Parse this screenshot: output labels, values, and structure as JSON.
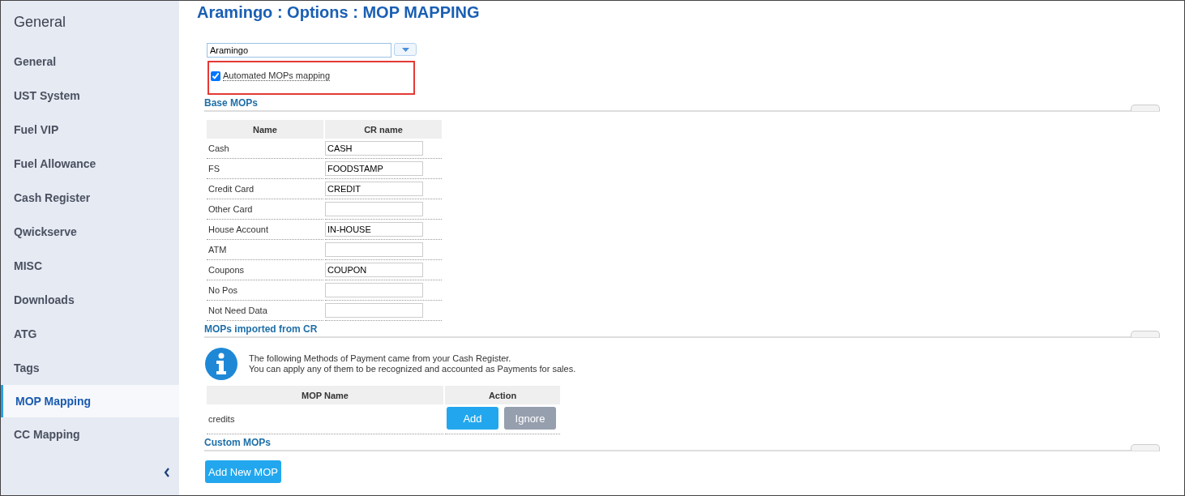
{
  "sidebar": {
    "heading": "General",
    "items": [
      {
        "label": "General",
        "selected": false
      },
      {
        "label": "UST System",
        "selected": false
      },
      {
        "label": "Fuel VIP",
        "selected": false
      },
      {
        "label": "Fuel Allowance",
        "selected": false
      },
      {
        "label": "Cash Register",
        "selected": false
      },
      {
        "label": "Qwickserve",
        "selected": false
      },
      {
        "label": "MISC",
        "selected": false
      },
      {
        "label": "Downloads",
        "selected": false
      },
      {
        "label": "ATG",
        "selected": false
      },
      {
        "label": "Tags",
        "selected": false
      },
      {
        "label": "MOP Mapping",
        "selected": true
      },
      {
        "label": "CC Mapping",
        "selected": false
      }
    ]
  },
  "page_title": "Aramingo : Options : MOP MAPPING",
  "store_select": {
    "value": "Aramingo"
  },
  "automated_mapping": {
    "label": "Automated MOPs mapping",
    "checked": true
  },
  "base_mops": {
    "title": "Base MOPs",
    "columns": [
      "Name",
      "CR name"
    ],
    "rows": [
      {
        "name": "Cash",
        "cr_name": "CASH"
      },
      {
        "name": "FS",
        "cr_name": "FOODSTAMP"
      },
      {
        "name": "Credit Card",
        "cr_name": "CREDIT"
      },
      {
        "name": "Other Card"
      },
      {
        "name": "House Account",
        "cr_name": "IN-HOUSE"
      },
      {
        "name": "ATM"
      },
      {
        "name": "Coupons",
        "cr_name": "COUPON"
      },
      {
        "name": "No Pos"
      },
      {
        "name": "Not Need Data"
      }
    ]
  },
  "imported_mops": {
    "title": "MOPs imported from CR",
    "info": [
      "The following Methods of Payment came from your Cash Register.",
      "You can apply any of them to be recognized and accounted as Payments for sales."
    ],
    "columns": [
      "MOP Name",
      "Action"
    ],
    "rows": [
      {
        "name": "credits",
        "actions": [
          "Add",
          "Ignore"
        ]
      }
    ]
  },
  "custom_mops": {
    "title": "Custom MOPs",
    "button": "Add New MOP"
  }
}
